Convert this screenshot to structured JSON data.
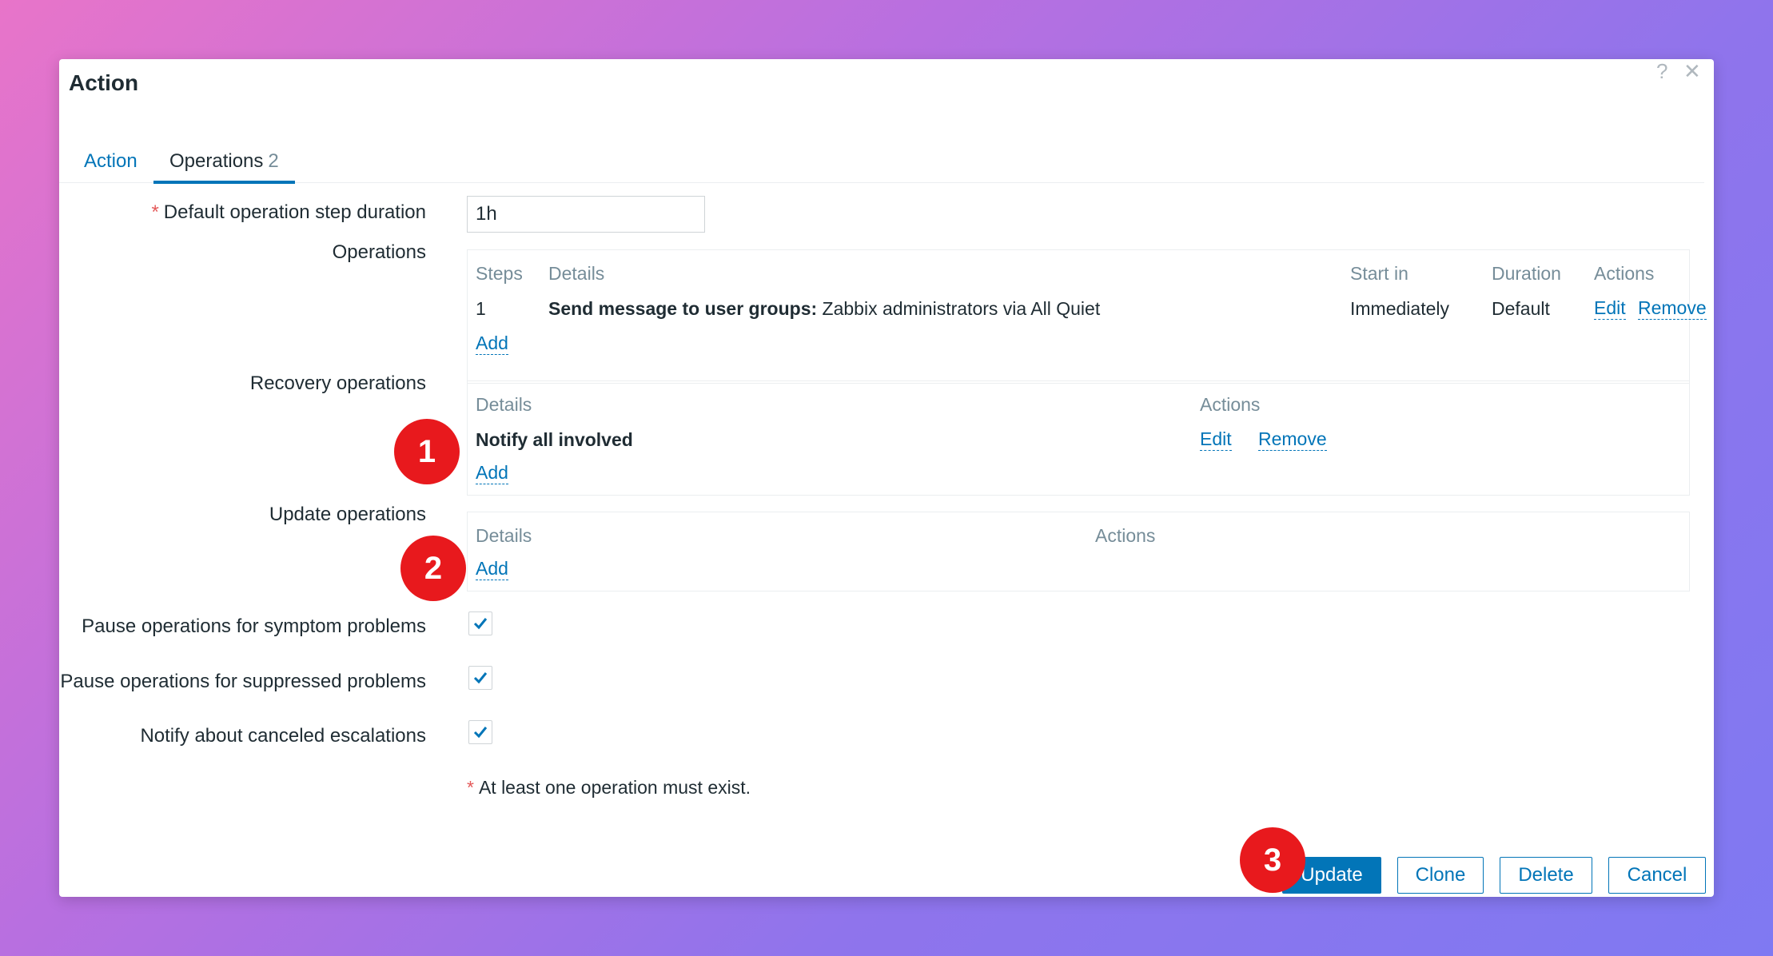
{
  "dialog": {
    "title": "Action",
    "help_glyph": "?",
    "close_glyph": "✕"
  },
  "tabs": [
    {
      "label": "Action"
    },
    {
      "label": "Operations",
      "count": "2"
    }
  ],
  "form": {
    "step_duration": {
      "label": "Default operation step duration",
      "required_mark": "*",
      "value": "1h"
    },
    "operations": {
      "label": "Operations",
      "headers": {
        "steps": "Steps",
        "details": "Details",
        "start_in": "Start in",
        "duration": "Duration",
        "actions": "Actions"
      },
      "rows": [
        {
          "steps": "1",
          "details_bold": "Send message to user groups:",
          "details_rest": "Zabbix administrators via All Quiet",
          "start_in": "Immediately",
          "duration": "Default",
          "edit": "Edit",
          "remove": "Remove"
        }
      ],
      "add": "Add"
    },
    "recovery_operations": {
      "label": "Recovery operations",
      "headers": {
        "details": "Details",
        "actions": "Actions"
      },
      "rows": [
        {
          "details": "Notify all involved",
          "edit": "Edit",
          "remove": "Remove"
        }
      ],
      "add": "Add"
    },
    "update_operations": {
      "label": "Update operations",
      "headers": {
        "details": "Details",
        "actions": "Actions"
      },
      "add": "Add"
    },
    "checkboxes": [
      {
        "label": "Pause operations for symptom problems",
        "checked": true
      },
      {
        "label": "Pause operations for suppressed problems",
        "checked": true
      },
      {
        "label": "Notify about canceled escalations",
        "checked": true
      }
    ],
    "note": {
      "mark": "*",
      "text": "At least one operation must exist."
    }
  },
  "buttons": {
    "update": "Update",
    "clone": "Clone",
    "delete": "Delete",
    "cancel": "Cancel"
  },
  "annotations": [
    "1",
    "2",
    "3"
  ],
  "colors": {
    "accent": "#0275b8",
    "required": "#e45959",
    "badge": "#e8191d"
  }
}
